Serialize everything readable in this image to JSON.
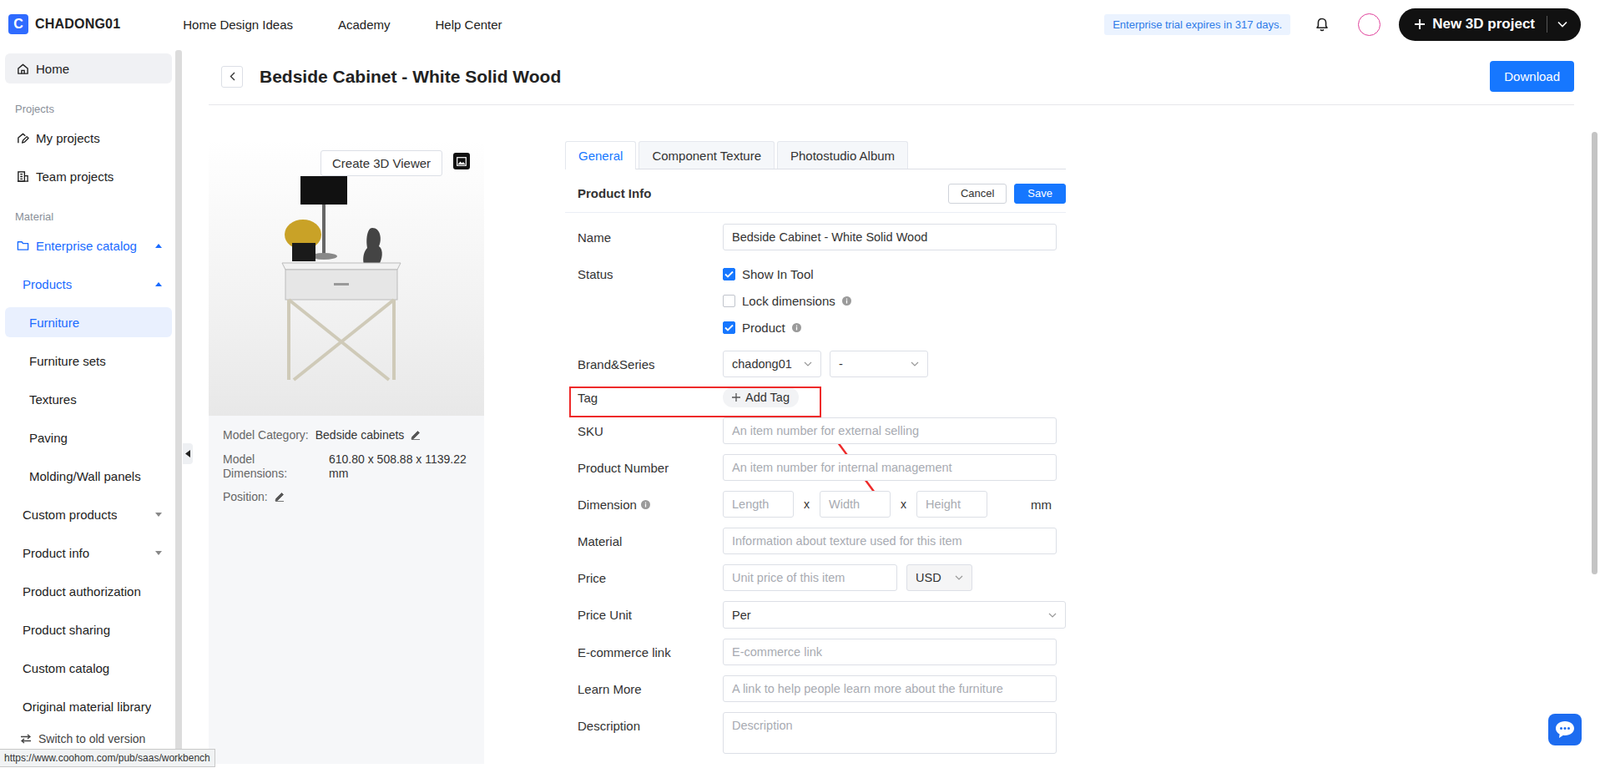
{
  "topbar": {
    "logo": "C",
    "brand": "CHADONG01",
    "nav": [
      "Home Design Ideas",
      "Academy",
      "Help Center"
    ],
    "trial": "Enterprise trial expires in 317 days.",
    "new_project": "New 3D project"
  },
  "sidebar": {
    "items": [
      {
        "label": "Home",
        "kind": "icon-item",
        "selected": false,
        "hovered": true,
        "active": false
      },
      {
        "label": "Projects",
        "kind": "section",
        "selected": false,
        "hovered": false,
        "active": false
      },
      {
        "label": "My projects",
        "kind": "icon-item",
        "selected": false,
        "hovered": false,
        "active": false
      },
      {
        "label": "Team projects",
        "kind": "icon-item",
        "selected": false,
        "hovered": false,
        "active": false
      },
      {
        "label": "Material",
        "kind": "section",
        "selected": false,
        "hovered": false,
        "active": false
      },
      {
        "label": "Enterprise catalog",
        "kind": "catalog",
        "selected": false,
        "hovered": false,
        "active": true,
        "expanded": true
      },
      {
        "label": "Products",
        "kind": "group",
        "selected": false,
        "hovered": false,
        "active": true,
        "expanded": true
      },
      {
        "label": "Furniture",
        "kind": "sub",
        "selected": true,
        "hovered": false,
        "active": false
      },
      {
        "label": "Furniture sets",
        "kind": "sub",
        "selected": false,
        "hovered": false,
        "active": false
      },
      {
        "label": "Textures",
        "kind": "sub",
        "selected": false,
        "hovered": false,
        "active": false
      },
      {
        "label": "Paving",
        "kind": "sub",
        "selected": false,
        "hovered": false,
        "active": false
      },
      {
        "label": "Molding/Wall panels",
        "kind": "sub",
        "selected": false,
        "hovered": false,
        "active": false
      },
      {
        "label": "Custom products",
        "kind": "group",
        "selected": false,
        "hovered": false,
        "active": false,
        "expanded": false
      },
      {
        "label": "Product info",
        "kind": "group",
        "selected": false,
        "hovered": false,
        "active": false,
        "expanded": false
      },
      {
        "label": "Product authorization",
        "kind": "item",
        "selected": false,
        "hovered": false,
        "active": false
      },
      {
        "label": "Product sharing",
        "kind": "item",
        "selected": false,
        "hovered": false,
        "active": false
      },
      {
        "label": "Custom catalog",
        "kind": "item",
        "selected": false,
        "hovered": false,
        "active": false
      },
      {
        "label": "Original material library",
        "kind": "item",
        "selected": false,
        "hovered": false,
        "active": false
      }
    ],
    "footer": "Switch to old version"
  },
  "status_url": "https://www.coohom.com/pub/saas/workbench",
  "page": {
    "title": "Bedside Cabinet - White Solid Wood",
    "download": "Download"
  },
  "preview": {
    "viewer_button": "Create 3D Viewer",
    "category_label": "Model Category:",
    "category": "Bedside cabinets",
    "dimensions_label": "Model Dimensions:",
    "dimensions": "610.80 x 508.88 x 1139.22 mm",
    "position_label": "Position:"
  },
  "tabs": [
    {
      "label": "General",
      "selected": true
    },
    {
      "label": "Component Texture",
      "selected": false
    },
    {
      "label": "Photostudio Album",
      "selected": false
    }
  ],
  "form": {
    "heading": "Product Info",
    "cancel": "Cancel",
    "save": "Save",
    "rows": [
      {
        "kind": "input",
        "label": "Name",
        "value": "Bedside Cabinet - White Solid Wood"
      },
      {
        "kind": "checks",
        "label": "Status",
        "options": [
          {
            "label": "Show In Tool",
            "checked": true,
            "info": false
          },
          {
            "label": "Lock dimensions",
            "checked": false,
            "info": true
          },
          {
            "label": "Product",
            "checked": true,
            "info": true
          }
        ]
      },
      {
        "kind": "selects",
        "label": "Brand&Series",
        "values": [
          "chadong01",
          "-"
        ]
      },
      {
        "kind": "tag",
        "label": "Tag",
        "button": "Add Tag",
        "highlighted": true
      },
      {
        "kind": "input",
        "label": "SKU",
        "placeholder": "An item number for external selling"
      },
      {
        "kind": "input",
        "label": "Product Number",
        "placeholder": "An item number for internal management"
      },
      {
        "kind": "dimension",
        "label": "Dimension",
        "info": true,
        "placeholders": [
          "Length",
          "Width",
          "Height"
        ],
        "separator": "x",
        "unit": "mm"
      },
      {
        "kind": "input",
        "label": "Material",
        "placeholder": "Information about texture used for this item"
      },
      {
        "kind": "price",
        "label": "Price",
        "placeholder": "Unit price of this item",
        "currency": "USD"
      },
      {
        "kind": "select",
        "label": "Price Unit",
        "value": "Per"
      },
      {
        "kind": "input",
        "label": "E-commerce link",
        "placeholder": "E-commerce link"
      },
      {
        "kind": "input",
        "label": "Learn More",
        "placeholder": "A link to help people learn more about the furniture"
      },
      {
        "kind": "textarea",
        "label": "Description",
        "placeholder": "Description"
      }
    ]
  }
}
